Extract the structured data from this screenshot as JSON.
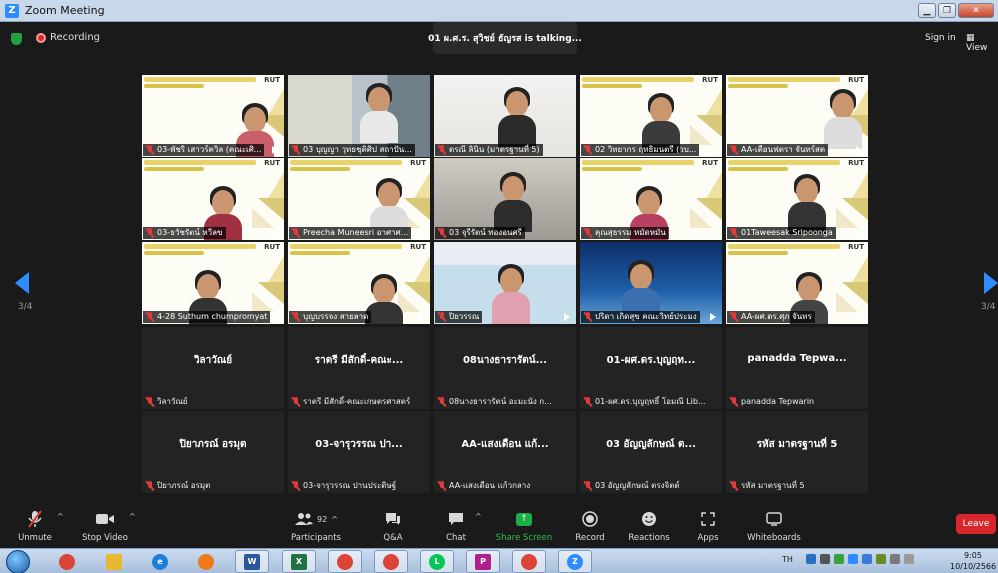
{
  "window": {
    "title": "Zoom Meeting"
  },
  "topbar": {
    "recording_label": "Recording",
    "talking": "01 ผ.ศ.ร. สุวิชย์ ธัญรส is talking...",
    "signin_label": "Sign in",
    "view_label": "View"
  },
  "pager": {
    "left": "3/4",
    "right": "3/4"
  },
  "video_tiles": [
    {
      "name": "03-พัชริ เสาวร์ควิล (คณะเศิ..."
    },
    {
      "name": "03 บุญญา วุทธชุติศิป สถาปัน..."
    },
    {
      "name": "ดรณี ลินิน (มาตรฐานที่ 5)"
    },
    {
      "name": "02 วิทยากร ฤทธิมนตรี (วบ..."
    },
    {
      "name": "AA-เตือนฟตรา จันทร์สต"
    },
    {
      "name": "03-ธวัชรัตน์ หวีลข"
    },
    {
      "name": "Preecha Muneesri อาศาศ..."
    },
    {
      "name": "03 จุรีรัตน์ ทองอนศรี"
    },
    {
      "name": "คุณสุธรรม หมัดหมัน"
    },
    {
      "name": "01Taweesak Sripoonga"
    },
    {
      "name": "4-28 Suthum chumpromyat"
    },
    {
      "name": "บุญบรรจง สายลาด"
    },
    {
      "name": "ปิยวรรณ"
    },
    {
      "name": "ปริดา เกิดสุข คณะวิทย์ประมง"
    },
    {
      "name": "AA-ผศ.ดร.ศุภ จันทร"
    }
  ],
  "blank_tiles": [
    {
      "display": "วิลาวัณย์",
      "tag": "วิลาวัณย์"
    },
    {
      "display": "ราตรี มีสักดิ์-คณะ...",
      "tag": "ราตรี มีสักดิ์-คณะเกษตรศาสตร์"
    },
    {
      "display": "08นางธารารัตน์...",
      "tag": "08นางธารารัตน์ อะมะนัง ก..."
    },
    {
      "display": "01-ผศ.ดร.บุญฤท...",
      "tag": "01-ผศ.ดร.บุญฤทธิ์ โอมณี Lib..."
    },
    {
      "display": "panadda Tepwa...",
      "tag": "panadda Tepwarin"
    },
    {
      "display": "ปิยาภรณ์ อรมุต",
      "tag": "ปิยาภรณ์ อรมุต"
    },
    {
      "display": "03-จารุวรรณ ปา...",
      "tag": "03-จารุวรรณ ปานประดิษฐ์"
    },
    {
      "display": "AA-แสงเดือน แก้...",
      "tag": "AA-แสงเดือน แก้วกลาง"
    },
    {
      "display": "03 อัญญลักษณ์ ต...",
      "tag": "03 อัญญลักษณ์ ตรงจิตต์"
    },
    {
      "display": "รหัส มาตรฐานที่ 5",
      "tag": "รหัส มาตรฐานที่ 5"
    }
  ],
  "slide": {
    "logo": "RUT"
  },
  "toolbar": {
    "unmute": "Unmute",
    "stop_video": "Stop Video",
    "participants": "Participants",
    "participant_count": "92",
    "qa": "Q&A",
    "chat": "Chat",
    "share_screen": "Share Screen",
    "record": "Record",
    "reactions": "Reactions",
    "apps": "Apps",
    "whiteboards": "Whiteboards",
    "leave": "Leave"
  },
  "taskbar": {
    "lang": "TH",
    "time": "9:05",
    "date": "10/10/2566",
    "apps": [
      "chrome",
      "explorer",
      "ie",
      "firefox",
      "word",
      "excel",
      "chrome",
      "chrome",
      "line",
      "pdf",
      "chrome-qa",
      "zoom"
    ]
  },
  "colors": {
    "accent": "#2d8cff",
    "leave": "#d9262c",
    "share": "#19b04a",
    "muted": "#e03a3a"
  }
}
